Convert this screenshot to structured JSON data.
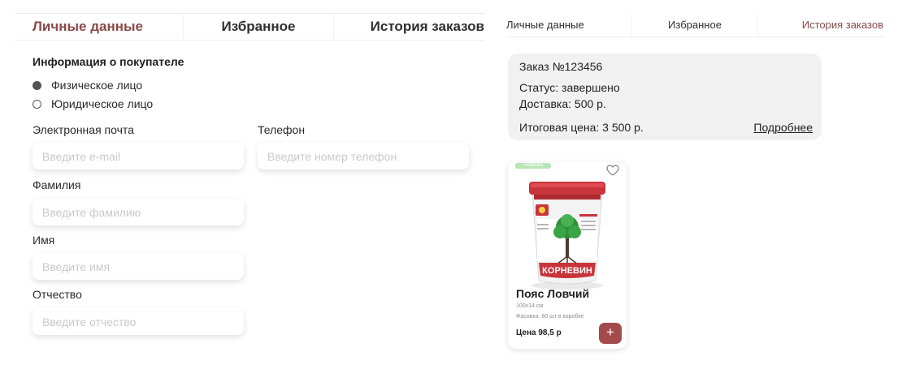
{
  "left_panel": {
    "tabs": [
      {
        "label": "Личные данные"
      },
      {
        "label": "Избранное"
      },
      {
        "label": "История заказов"
      }
    ],
    "section_title": "Информация о покупателе",
    "buyer_types": [
      {
        "label": "Физическое лицо",
        "checked": true
      },
      {
        "label": "Юридическое лицо",
        "checked": false
      }
    ],
    "fields": {
      "email": {
        "label": "Электронная почта",
        "placeholder": "Введите e-mail"
      },
      "phone": {
        "label": "Телефон",
        "placeholder": "Введите номер телефон"
      },
      "surname": {
        "label": "Фамилия",
        "placeholder": "Введите фамилию"
      },
      "name": {
        "label": "Имя",
        "placeholder": "Введите имя"
      },
      "patronymic": {
        "label": "Отчество",
        "placeholder": "Введите отчество"
      }
    }
  },
  "right_panel": {
    "tabs": [
      {
        "label": "Личные данные"
      },
      {
        "label": "Избранное"
      },
      {
        "label": "История заказов"
      }
    ],
    "order": {
      "number": "Заказ №123456",
      "status": "Статус: завершено",
      "delivery": "Доставка: 500 р.",
      "total": "Итоговая цена: 3 500 р.",
      "details_link": "Подробнее"
    },
    "product": {
      "badge": "Новинка",
      "title": "Пояс Ловчий",
      "size": "100x14 см",
      "packing": "Фасовка: 60 шт в коробке",
      "price": "Цена 98,5 р",
      "add_label": "+",
      "image_label": "КОРНЕВИН"
    }
  },
  "colors": {
    "accent": "#8a4a4a",
    "button": "#a34b4b",
    "card_bg": "#f1f1f1",
    "badge": "#b7e6b5"
  }
}
